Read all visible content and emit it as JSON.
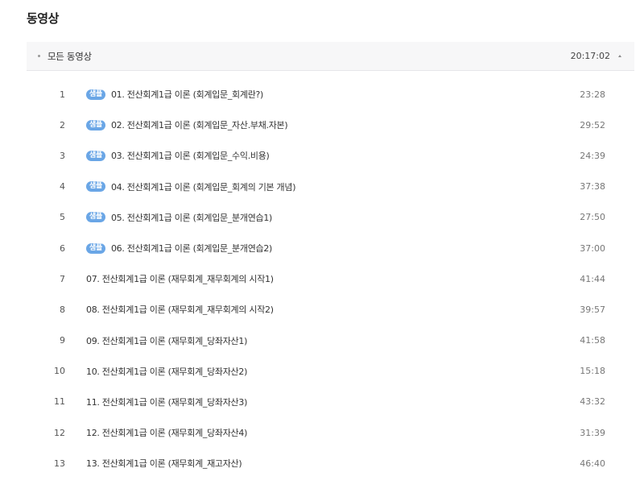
{
  "page_title": "동영상",
  "section": {
    "title": "모든 동영상",
    "total_duration": "20:17:02"
  },
  "videos": [
    {
      "index": "1",
      "sample": true,
      "title": "01. 전산회계1급 이론 (회계입문_회계란?)",
      "duration": "23:28"
    },
    {
      "index": "2",
      "sample": true,
      "title": "02. 전산회계1급 이론 (회계입문_자산.부채.자본)",
      "duration": "29:52"
    },
    {
      "index": "3",
      "sample": true,
      "title": "03. 전산회계1급 이론 (회계입문_수익.비용)",
      "duration": "24:39"
    },
    {
      "index": "4",
      "sample": true,
      "title": "04. 전산회계1급 이론 (회계입문_회계의 기본 개념)",
      "duration": "37:38"
    },
    {
      "index": "5",
      "sample": true,
      "title": "05. 전산회계1급 이론 (회계입문_분개연습1)",
      "duration": "27:50"
    },
    {
      "index": "6",
      "sample": true,
      "title": "06. 전산회계1급 이론 (회계입문_분개연습2)",
      "duration": "37:00"
    },
    {
      "index": "7",
      "sample": false,
      "title": "07. 전산회계1급 이론 (재무회계_재무회계의 시작1)",
      "duration": "41:44"
    },
    {
      "index": "8",
      "sample": false,
      "title": "08. 전산회계1급 이론 (재무회계_재무회계의 시작2)",
      "duration": "39:57"
    },
    {
      "index": "9",
      "sample": false,
      "title": "09. 전산회계1급 이론 (재무회계_당좌자산1)",
      "duration": "41:58"
    },
    {
      "index": "10",
      "sample": false,
      "title": "10. 전산회계1급 이론 (재무회계_당좌자산2)",
      "duration": "15:18"
    },
    {
      "index": "11",
      "sample": false,
      "title": "11. 전산회계1급 이론 (재무회계_당좌자산3)",
      "duration": "43:32"
    },
    {
      "index": "12",
      "sample": false,
      "title": "12. 전산회계1급 이론 (재무회계_당좌자산4)",
      "duration": "31:39"
    },
    {
      "index": "13",
      "sample": false,
      "title": "13. 전산회계1급 이론 (재무회계_재고자산)",
      "duration": "46:40"
    }
  ],
  "sample_badge_label": "샘플",
  "colors": {
    "badge": "#6aa6e6",
    "header_bg": "#f7f7f8"
  }
}
